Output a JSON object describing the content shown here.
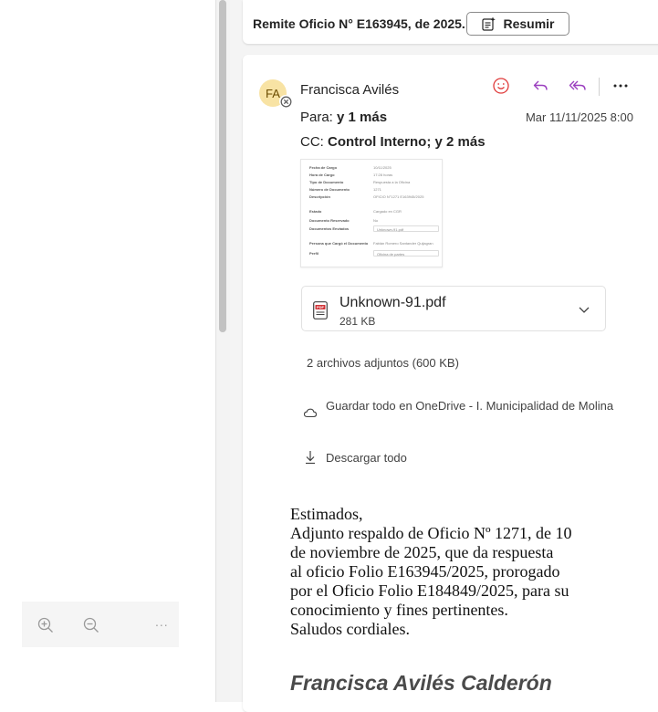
{
  "left": {
    "zoom_in_label": "Zoom in",
    "zoom_out_label": "Zoom out",
    "more_label": "..."
  },
  "top_card": {
    "summary": "Remite Oficio N° E163945, de 2025.",
    "resumir": "Resumir"
  },
  "message": {
    "avatar_initials": "FA",
    "sender": "Francisca Avilés",
    "to_label": "Para:",
    "to_value": "y 1 más",
    "date": "Mar 11/11/2025 8:00",
    "cc_label": "CC:",
    "cc_value": "Control Interno;  y 2 más",
    "actions": {
      "react": "smile-icon",
      "reply": "reply-icon",
      "reply_all": "reply-all-icon",
      "more": "..."
    },
    "colors": {
      "react": "#e03b3b",
      "reply": "#9b3fbf",
      "avatar_bg": "#f8e3a4"
    }
  },
  "thumbnail": {
    "rows": [
      {
        "k": "Fecha de Cargo",
        "v": "10/11/2025"
      },
      {
        "k": "Hora de Cargo",
        "v": "17:28 horas"
      },
      {
        "k": "Tipo de Documento",
        "v": "Respuesta a la Oficina"
      },
      {
        "k": "Número de Documento",
        "v": "1271"
      },
      {
        "k": "Descripción",
        "v": "OFICIO N°1271 E163945/2025"
      },
      {
        "k": "Estado",
        "v": "Cargado en CGR"
      },
      {
        "k": "Documento Reservado",
        "v": "No"
      },
      {
        "k": "Documentos Enviados",
        "v": "Unknown-91.pdf"
      },
      {
        "k": "Persona que Cargó el Documento",
        "v": "Fabián Romero Santander Quijagran"
      },
      {
        "k": "Perfil",
        "v": "Oficina de partes"
      }
    ]
  },
  "attachment": {
    "name": "Unknown-91.pdf",
    "size": "281 KB"
  },
  "attachments_summary": "2 archivos adjuntos (600 KB)",
  "onedrive": "Guardar todo en OneDrive - I. Municipalidad de Molina",
  "download": "Descargar todo",
  "body": [
    "Estimados,",
    "Adjunto respaldo de Oficio Nº 1271, de 10",
    "de noviembre de 2025, que da respuesta",
    "al oficio Folio E163945/2025, prorogado",
    "por el Oficio Folio E184849/2025, para su",
    "conocimiento y fines pertinentes.",
    "Saludos cordiales."
  ],
  "signature": "Francisca Avilés Calderón"
}
